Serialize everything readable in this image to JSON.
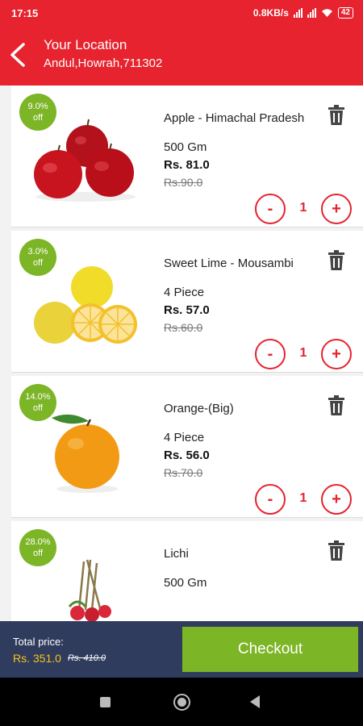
{
  "status_bar": {
    "time": "17:15",
    "speed": "0.8KB/s",
    "battery": "42"
  },
  "header": {
    "title": "Your Location",
    "subtitle": "Andul,Howrah,711302"
  },
  "items": [
    {
      "discount": "9.0%",
      "off": "off",
      "name": "Apple - Himachal Pradesh",
      "qty": "500 Gm",
      "price": "Rs. 81.0",
      "mrp": "Rs.90.0",
      "count": "1",
      "minus": "-",
      "plus": "+"
    },
    {
      "discount": "3.0%",
      "off": "off",
      "name": "Sweet Lime - Mousambi",
      "qty": "4 Piece",
      "price": "Rs. 57.0",
      "mrp": "Rs.60.0",
      "count": "1",
      "minus": "-",
      "plus": "+"
    },
    {
      "discount": "14.0%",
      "off": "off",
      "name": "Orange-(Big)",
      "qty": "4 Piece",
      "price": "Rs. 56.0",
      "mrp": "Rs.70.0",
      "count": "1",
      "minus": "-",
      "plus": "+"
    },
    {
      "discount": "28.0%",
      "off": "off",
      "name": "Lichi",
      "qty": "500 Gm"
    }
  ],
  "footer": {
    "total_label": "Total price:",
    "total_price": "Rs. 351.0",
    "total_mrp": "Rs. 410.0",
    "checkout": "Checkout"
  },
  "colors": {
    "primary": "#e6232e",
    "accent": "#7cb526",
    "footer_bg": "#2f3c5e",
    "total_price": "#f5c518"
  }
}
